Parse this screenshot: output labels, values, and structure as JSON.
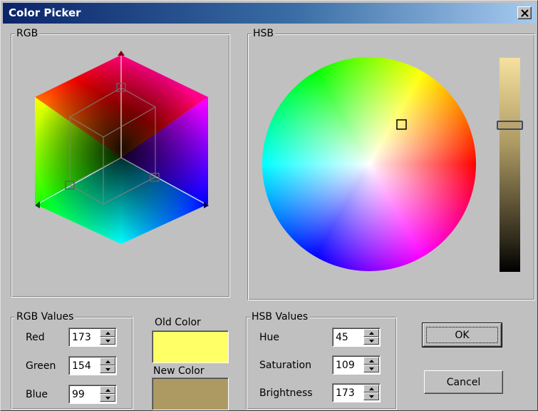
{
  "window": {
    "title": "Color Picker"
  },
  "rgb_panel": {
    "label": "RGB"
  },
  "hsb_panel": {
    "label": "HSB"
  },
  "rgb_values": {
    "label": "RGB Values",
    "red_label": "Red",
    "red": "173",
    "green_label": "Green",
    "green": "154",
    "blue_label": "Blue",
    "blue": "99"
  },
  "swatches": {
    "old_label": "Old Color",
    "old_color": "#ffff66",
    "new_label": "New Color",
    "new_color": "#ad9a63"
  },
  "hsb_values": {
    "label": "HSB Values",
    "hue_label": "Hue",
    "hue": "45",
    "saturation_label": "Saturation",
    "saturation": "109",
    "brightness_label": "Brightness",
    "brightness": "173"
  },
  "buttons": {
    "ok": "OK",
    "cancel": "Cancel"
  }
}
